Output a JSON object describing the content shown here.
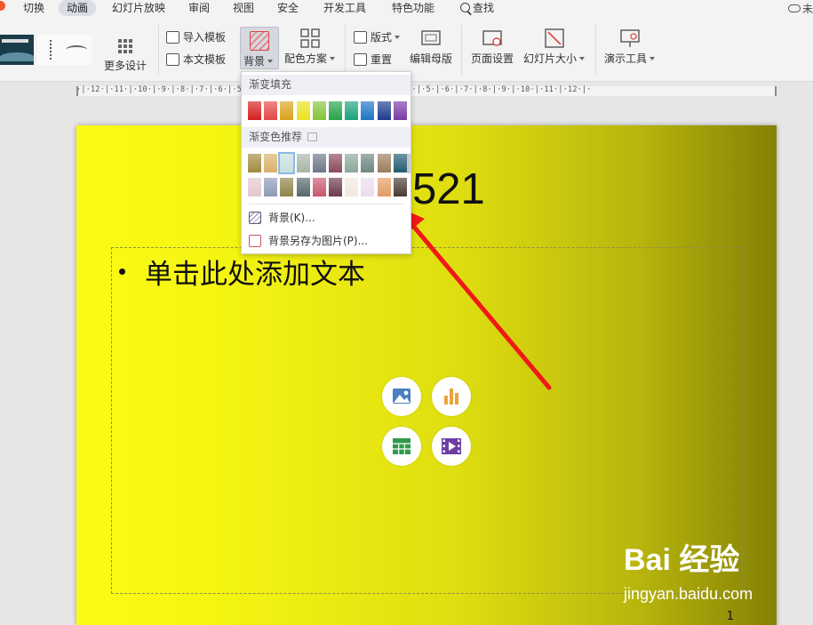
{
  "menu": {
    "tabs": [
      "切换",
      "动画",
      "幻灯片放映",
      "审阅",
      "视图",
      "安全",
      "开发工具",
      "特色功能"
    ],
    "active_tab": "动画",
    "search_label": "查找",
    "cloud_label": "未"
  },
  "ribbon": {
    "more_design": "更多设计",
    "import_template": "导入模板",
    "text_template": "本文模板",
    "background": "背景",
    "color_scheme": "配色方案",
    "layout": "版式",
    "reset": "重置",
    "edit_master": "编辑母版",
    "page_setup": "页面设置",
    "slide_size": "幻灯片大小",
    "presenter_tools": "演示工具"
  },
  "ruler": {
    "ticks": "·|·12·|·11·|·10·|·9·|·8·|·7·|·6·|·5·|·4·|·3·|·2·|·1·|·0·|·1·|·2·|·3·|·4·|·5·|·6·|·7·|·8·|·9·|·10·|·11·|·12·|·"
  },
  "slide": {
    "title_fragment": "521",
    "bullet_text": "单击此处添加文本",
    "page_number": "1"
  },
  "dropdown": {
    "gradient_fill_header": "渐变填充",
    "recommended_header": "渐变色推荐",
    "fill_swatches": [
      "#d41f1f",
      "#e34646",
      "#d9a21b",
      "#e8e21c",
      "#86c33a",
      "#25a34a",
      "#1aa27a",
      "#1b74c4",
      "#1e3b8f",
      "#7a39a6"
    ],
    "recommended_row1": [
      "#a28a3f",
      "#d9b06a",
      "#c8dedc",
      "#a9b5a8",
      "#6c7789",
      "#8a4a5c",
      "#8aa89a",
      "#6f8580",
      "#9a7c5c",
      "#235a70"
    ],
    "recommended_row2": [
      "#e4c6cf",
      "#8d9ab6",
      "#8e8248",
      "#55676a",
      "#c9566d",
      "#6a3a4a",
      "#f2e8df",
      "#ecdcea",
      "#e39a64",
      "#4a3a32"
    ],
    "selected_swatch": "recommended_row1.2",
    "item_background": "背景(K)...",
    "item_save_background": "背景另存为图片(P)..."
  },
  "watermark": {
    "main": "Bai 经验",
    "sub": "jingyan.baidu.com"
  },
  "colors": {
    "arrow": "#f01818",
    "slide_gradient_start": "#fbfb16",
    "slide_gradient_end": "#858105",
    "accent_blue": "#4a7fc1",
    "accent_orange": "#e9a53c",
    "accent_green": "#2e9a4a",
    "accent_purple": "#6e3fa3"
  }
}
